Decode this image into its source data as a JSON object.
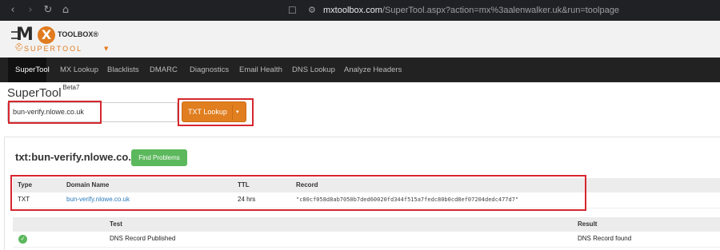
{
  "browser": {
    "back_icon": "chevron-left-icon",
    "forward_icon": "chevron-right-icon",
    "url_host": "mxtoolbox.com",
    "url_path": "/SuperTool.aspx?action=mx%3aalenwalker.uk&run=toolpage"
  },
  "logo": {
    "mx": "M",
    "x": "X",
    "toolbox": "TOOLBOX",
    "reg": "®",
    "supertool": "SUPERTOOL"
  },
  "nav": {
    "items": [
      "SuperTool",
      "MX Lookup",
      "Blacklists",
      "DMARC",
      "Diagnostics",
      "Email Health",
      "DNS Lookup",
      "Analyze Headers"
    ]
  },
  "page": {
    "title": "SuperTool",
    "beta": "Beta7"
  },
  "search": {
    "value": "bun-verify.nlowe.co.uk"
  },
  "lookup_button": {
    "label": "TXT Lookup",
    "dropdown_glyph": "▾"
  },
  "result": {
    "title": "txt:bun-verify.nlowe.co.uk",
    "find_problems": "Find Problems",
    "columns": [
      "Type",
      "Domain Name",
      "TTL",
      "Record"
    ],
    "rows": [
      {
        "type": "TXT",
        "domain": "bun-verify.nlowe.co.uk",
        "ttl": "24 hrs",
        "record": "\"c80cf058d8ab7050b7ded60020fd344f515a7fedc80b0cd8ef07204dedc477d7\""
      }
    ]
  },
  "tests": {
    "columns": [
      "Test",
      "Result"
    ],
    "rows": [
      {
        "status_icon": "check-circle-icon",
        "test": "DNS Record Published",
        "result": "DNS Record found"
      }
    ]
  },
  "colors": {
    "accent_orange": "#e17e1f",
    "success_green": "#5cb85c",
    "highlight_red": "#d6262f",
    "nav_dark": "#222222"
  }
}
